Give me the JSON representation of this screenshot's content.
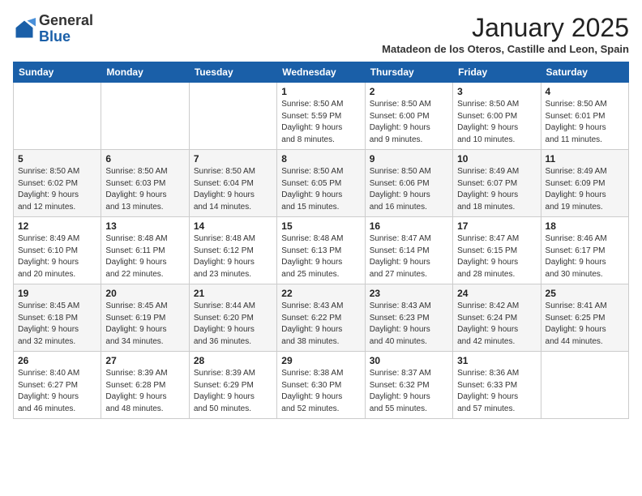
{
  "logo": {
    "general": "General",
    "blue": "Blue"
  },
  "header": {
    "month_year": "January 2025",
    "subtitle": "Matadeon de los Oteros, Castille and Leon, Spain"
  },
  "weekdays": [
    "Sunday",
    "Monday",
    "Tuesday",
    "Wednesday",
    "Thursday",
    "Friday",
    "Saturday"
  ],
  "weeks": [
    [
      {
        "day": "",
        "info": ""
      },
      {
        "day": "",
        "info": ""
      },
      {
        "day": "",
        "info": ""
      },
      {
        "day": "1",
        "info": "Sunrise: 8:50 AM\nSunset: 5:59 PM\nDaylight: 9 hours\nand 8 minutes."
      },
      {
        "day": "2",
        "info": "Sunrise: 8:50 AM\nSunset: 6:00 PM\nDaylight: 9 hours\nand 9 minutes."
      },
      {
        "day": "3",
        "info": "Sunrise: 8:50 AM\nSunset: 6:00 PM\nDaylight: 9 hours\nand 10 minutes."
      },
      {
        "day": "4",
        "info": "Sunrise: 8:50 AM\nSunset: 6:01 PM\nDaylight: 9 hours\nand 11 minutes."
      }
    ],
    [
      {
        "day": "5",
        "info": "Sunrise: 8:50 AM\nSunset: 6:02 PM\nDaylight: 9 hours\nand 12 minutes."
      },
      {
        "day": "6",
        "info": "Sunrise: 8:50 AM\nSunset: 6:03 PM\nDaylight: 9 hours\nand 13 minutes."
      },
      {
        "day": "7",
        "info": "Sunrise: 8:50 AM\nSunset: 6:04 PM\nDaylight: 9 hours\nand 14 minutes."
      },
      {
        "day": "8",
        "info": "Sunrise: 8:50 AM\nSunset: 6:05 PM\nDaylight: 9 hours\nand 15 minutes."
      },
      {
        "day": "9",
        "info": "Sunrise: 8:50 AM\nSunset: 6:06 PM\nDaylight: 9 hours\nand 16 minutes."
      },
      {
        "day": "10",
        "info": "Sunrise: 8:49 AM\nSunset: 6:07 PM\nDaylight: 9 hours\nand 18 minutes."
      },
      {
        "day": "11",
        "info": "Sunrise: 8:49 AM\nSunset: 6:09 PM\nDaylight: 9 hours\nand 19 minutes."
      }
    ],
    [
      {
        "day": "12",
        "info": "Sunrise: 8:49 AM\nSunset: 6:10 PM\nDaylight: 9 hours\nand 20 minutes."
      },
      {
        "day": "13",
        "info": "Sunrise: 8:48 AM\nSunset: 6:11 PM\nDaylight: 9 hours\nand 22 minutes."
      },
      {
        "day": "14",
        "info": "Sunrise: 8:48 AM\nSunset: 6:12 PM\nDaylight: 9 hours\nand 23 minutes."
      },
      {
        "day": "15",
        "info": "Sunrise: 8:48 AM\nSunset: 6:13 PM\nDaylight: 9 hours\nand 25 minutes."
      },
      {
        "day": "16",
        "info": "Sunrise: 8:47 AM\nSunset: 6:14 PM\nDaylight: 9 hours\nand 27 minutes."
      },
      {
        "day": "17",
        "info": "Sunrise: 8:47 AM\nSunset: 6:15 PM\nDaylight: 9 hours\nand 28 minutes."
      },
      {
        "day": "18",
        "info": "Sunrise: 8:46 AM\nSunset: 6:17 PM\nDaylight: 9 hours\nand 30 minutes."
      }
    ],
    [
      {
        "day": "19",
        "info": "Sunrise: 8:45 AM\nSunset: 6:18 PM\nDaylight: 9 hours\nand 32 minutes."
      },
      {
        "day": "20",
        "info": "Sunrise: 8:45 AM\nSunset: 6:19 PM\nDaylight: 9 hours\nand 34 minutes."
      },
      {
        "day": "21",
        "info": "Sunrise: 8:44 AM\nSunset: 6:20 PM\nDaylight: 9 hours\nand 36 minutes."
      },
      {
        "day": "22",
        "info": "Sunrise: 8:43 AM\nSunset: 6:22 PM\nDaylight: 9 hours\nand 38 minutes."
      },
      {
        "day": "23",
        "info": "Sunrise: 8:43 AM\nSunset: 6:23 PM\nDaylight: 9 hours\nand 40 minutes."
      },
      {
        "day": "24",
        "info": "Sunrise: 8:42 AM\nSunset: 6:24 PM\nDaylight: 9 hours\nand 42 minutes."
      },
      {
        "day": "25",
        "info": "Sunrise: 8:41 AM\nSunset: 6:25 PM\nDaylight: 9 hours\nand 44 minutes."
      }
    ],
    [
      {
        "day": "26",
        "info": "Sunrise: 8:40 AM\nSunset: 6:27 PM\nDaylight: 9 hours\nand 46 minutes."
      },
      {
        "day": "27",
        "info": "Sunrise: 8:39 AM\nSunset: 6:28 PM\nDaylight: 9 hours\nand 48 minutes."
      },
      {
        "day": "28",
        "info": "Sunrise: 8:39 AM\nSunset: 6:29 PM\nDaylight: 9 hours\nand 50 minutes."
      },
      {
        "day": "29",
        "info": "Sunrise: 8:38 AM\nSunset: 6:30 PM\nDaylight: 9 hours\nand 52 minutes."
      },
      {
        "day": "30",
        "info": "Sunrise: 8:37 AM\nSunset: 6:32 PM\nDaylight: 9 hours\nand 55 minutes."
      },
      {
        "day": "31",
        "info": "Sunrise: 8:36 AM\nSunset: 6:33 PM\nDaylight: 9 hours\nand 57 minutes."
      },
      {
        "day": "",
        "info": ""
      }
    ]
  ]
}
